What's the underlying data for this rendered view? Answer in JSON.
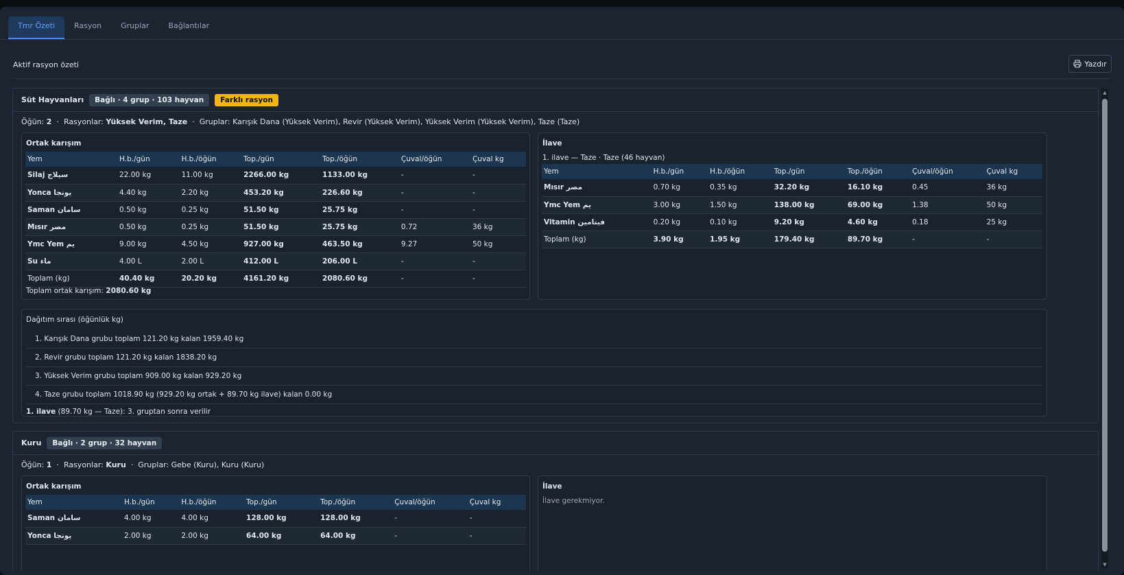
{
  "tabs": [
    "Tmr Özeti",
    "Rasyon",
    "Gruplar",
    "Bağlantılar"
  ],
  "toolbar": {
    "title": "Aktif rasyon özeti",
    "print_label": "Yazdır"
  },
  "s1": {
    "name": "Süt Hayvanları",
    "badge": "Bağlı · 4 grup · 103 hayvan",
    "warn": "Farklı rasyon",
    "meta": {
      "ogun_label": "Öğün:",
      "ogun": "2",
      "rasyon_label": "Rasyonlar:",
      "rasyonlar": "Yüksek Verim, Taze",
      "gruplar_label": "Gruplar:",
      "gruplar": "Karışık Dana (Yüksek Verim), Revir (Yüksek Verim), Yüksek Verim (Yüksek Verim), Taze (Taze)"
    },
    "mix": {
      "title": "Ortak karışım",
      "headers": [
        "Yem",
        "H.b./gün",
        "H.b./öğün",
        "Top./gün",
        "Top./öğün",
        "Çuval/öğün",
        "Çuval kg"
      ],
      "rows": [
        [
          "Silaj سيلاج",
          "22.00 kg",
          "11.00 kg",
          "2266.00 kg",
          "1133.00 kg",
          "-",
          "-"
        ],
        [
          "Yonca يونجا",
          "4.40 kg",
          "2.20 kg",
          "453.20 kg",
          "226.60 kg",
          "-",
          "-"
        ],
        [
          "Saman سامان",
          "0.50 kg",
          "0.25 kg",
          "51.50 kg",
          "25.75 kg",
          "-",
          "-"
        ],
        [
          "Mısır مصر",
          "0.50 kg",
          "0.25 kg",
          "51.50 kg",
          "25.75 kg",
          "0.72",
          "36 kg"
        ],
        [
          "Ymc Yem يم",
          "9.00 kg",
          "4.50 kg",
          "927.00 kg",
          "463.50 kg",
          "9.27",
          "50 kg"
        ],
        [
          "Su ماء",
          "4.00 L",
          "2.00 L",
          "412.00 L",
          "206.00 L",
          "-",
          "-"
        ],
        [
          "Toplam (kg)",
          "40.40 kg",
          "20.20 kg",
          "4161.20 kg",
          "2080.60 kg",
          "-",
          "-"
        ]
      ],
      "total_label": "Toplam ortak karışım:",
      "total_value": "2080.60 kg"
    },
    "ilave": {
      "title": "İlave",
      "subtitle": "1. ilave — Taze · Taze (46 hayvan)",
      "headers": [
        "Yem",
        "H.b./gün",
        "H.b./öğün",
        "Top./gün",
        "Top./öğün",
        "Çuval/öğün",
        "Çuval kg"
      ],
      "rows": [
        [
          "Mısır مصر",
          "0.70 kg",
          "0.35 kg",
          "32.20 kg",
          "16.10 kg",
          "0.45",
          "36 kg"
        ],
        [
          "Ymc Yem يم",
          "3.00 kg",
          "1.50 kg",
          "138.00 kg",
          "69.00 kg",
          "1.38",
          "50 kg"
        ],
        [
          "Vitamin فيتامين",
          "0.20 kg",
          "0.10 kg",
          "9.20 kg",
          "4.60 kg",
          "0.18",
          "25 kg"
        ],
        [
          "Toplam (kg)",
          "3.90 kg",
          "1.95 kg",
          "179.40 kg",
          "89.70 kg",
          "-",
          "-"
        ]
      ]
    },
    "dagitim": {
      "title": "Dağıtım sırası (öğünlük kg)",
      "items": [
        "1. Karışık Dana grubu toplam 121.20 kg kalan 1959.40 kg",
        "2. Revir grubu toplam 121.20 kg kalan 1838.20 kg",
        "3. Yüksek Verim grubu toplam 909.00 kg kalan 929.20 kg",
        "4. Taze grubu toplam 1018.90 kg (929.20 kg ortak + 89.70 kg ilave) kalan 0.00 kg"
      ],
      "note_bold": "1. ilave",
      "note_rest": "(89.70 kg — Taze): 3. gruptan sonra verilir"
    }
  },
  "s2": {
    "name": "Kuru",
    "badge": "Bağlı · 2 grup · 32 hayvan",
    "meta": {
      "ogun_label": "Öğün:",
      "ogun": "1",
      "rasyon_label": "Rasyonlar:",
      "rasyonlar": "Kuru",
      "gruplar_label": "Gruplar:",
      "gruplar": "Gebe (Kuru), Kuru (Kuru)"
    },
    "mix": {
      "title": "Ortak karışım",
      "headers": [
        "Yem",
        "H.b./gün",
        "H.b./öğün",
        "Top./gün",
        "Top./öğün",
        "Çuval/öğün",
        "Çuval kg"
      ],
      "rows": [
        [
          "Saman سامان",
          "4.00 kg",
          "4.00 kg",
          "128.00 kg",
          "128.00 kg",
          "-",
          "-"
        ],
        [
          "Yonca يونجا",
          "2.00 kg",
          "2.00 kg",
          "64.00 kg",
          "64.00 kg",
          "-",
          "-"
        ]
      ]
    },
    "ilave": {
      "title": "İlave",
      "empty": "İlave gerekmiyor."
    }
  },
  "colors": {
    "accent": "#3d8bff",
    "warn": "#f3b514",
    "bg": "#1b2430",
    "header_row": "#1d3650"
  }
}
